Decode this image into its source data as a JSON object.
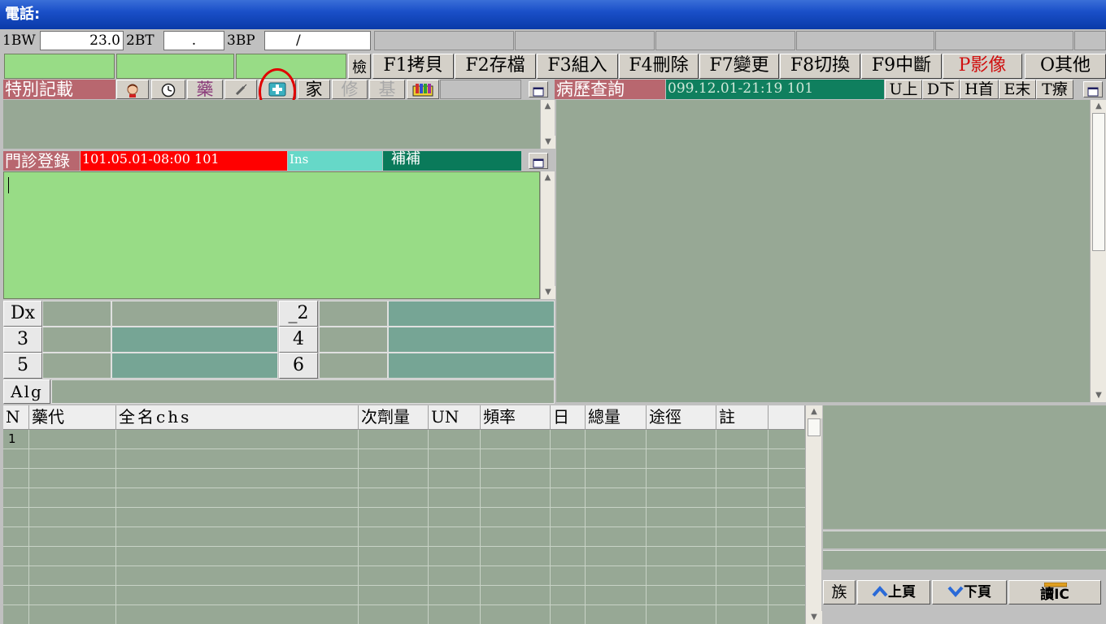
{
  "window": {
    "title": "電話:"
  },
  "vitals": {
    "bw_label": "1BW",
    "bw_value": "23.0",
    "bt_label": "2BT",
    "bt_value": ".",
    "bp_label": "3BP",
    "bp_value": "/"
  },
  "toolbar": {
    "check_label": "檢",
    "buttons": [
      "F1拷貝",
      "F2存檔",
      "F3組入",
      "F4刪除",
      "F7變更",
      "F8切換",
      "F9中斷",
      "P影像",
      "O其他"
    ]
  },
  "special_notes": {
    "title": "特別記載",
    "med_label": "藥",
    "family_label": "家",
    "edit_label": "修",
    "base_label": "基"
  },
  "history": {
    "title": "病歷查詢",
    "record": "099.12.01-21:19 101",
    "nav": [
      "U上",
      "D下",
      "H首",
      "E末",
      "T療"
    ]
  },
  "registration": {
    "title": "門診登錄",
    "datetime": "101.05.01-08:00 101",
    "ins": "Ins",
    "supplement": "補補"
  },
  "diagnosis": {
    "labels": [
      "Dx",
      "_2",
      "3",
      "4",
      "5",
      "6"
    ],
    "alg_label": "Alg"
  },
  "drug_table": {
    "headers": [
      "N",
      "藥代",
      "全名chs",
      "次劑量",
      "UN",
      "頻率",
      "日",
      "總量",
      "途徑",
      "註"
    ],
    "rows": [
      [
        "1",
        "",
        "",
        "",
        "",
        "",
        "",
        "",
        "",
        ""
      ]
    ]
  },
  "bottom_buttons": {
    "family": "族",
    "page_up": "上頁",
    "page_down": "下頁",
    "read_ic": "讀IC"
  },
  "colors": {
    "title_bar": "#1a4fc8",
    "header_pink": "#b8676f",
    "red_bar": "#ff0000",
    "cyan_bar": "#66d8c8",
    "teal_bar": "#0a7a5a",
    "panel_gray_green": "#97a895",
    "light_green": "#98dc86",
    "highlight_circle": "#e00000"
  }
}
